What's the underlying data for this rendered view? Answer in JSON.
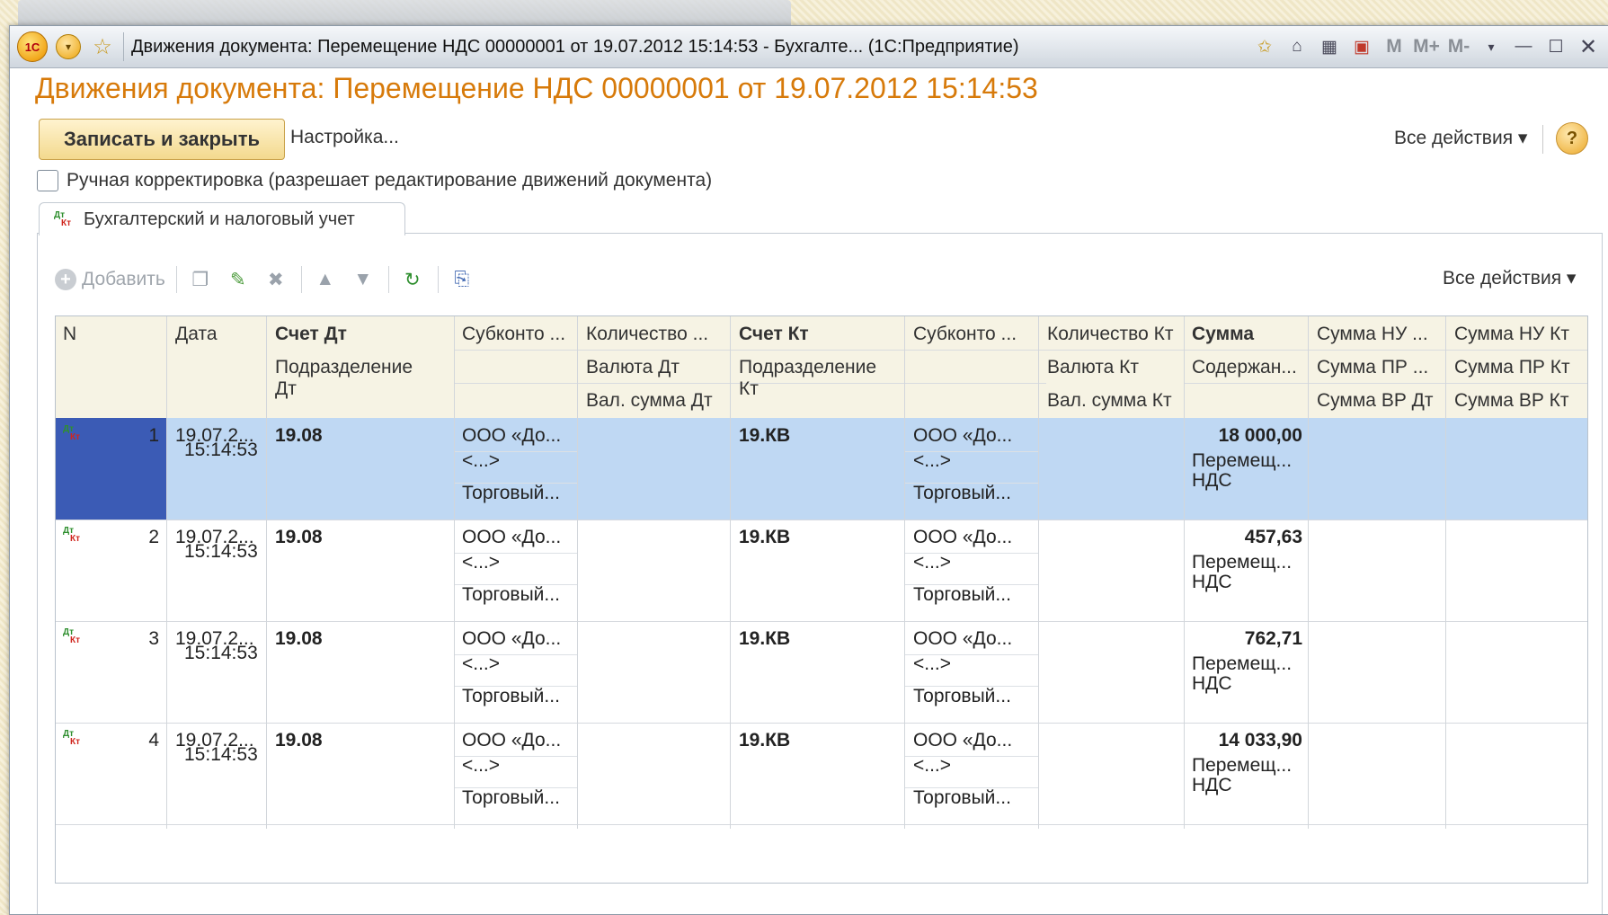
{
  "window": {
    "title": "Движения документа: Перемещение НДС 00000001 от 19.07.2012 15:14:53 - Бухгалте...  (1С:Предприятие)",
    "logo": "1С"
  },
  "document": {
    "heading": "Движения документа: Перемещение НДС 00000001 от 19.07.2012 15:14:53"
  },
  "actions": {
    "save_close": "Записать и закрыть",
    "settings": "Настройка...",
    "all_actions": "Все действия ▾",
    "help": "?"
  },
  "manual_edit": {
    "checked": false,
    "label": "Ручная корректировка (разрешает редактирование движений документа)"
  },
  "tab": {
    "icon_dt": "Дт",
    "icon_kt": "Кт",
    "label": "Бухгалтерский и налоговый учет"
  },
  "grid_toolbar": {
    "add": "Добавить",
    "all_actions": "Все действия ▾"
  },
  "titlebar_icons": {
    "m": "M",
    "m_plus": "M+",
    "m_minus": "M-"
  },
  "columns": {
    "n": "N",
    "date": "Дата",
    "acc_dt": "Счет Дт",
    "sub_dt": "Субконто ...",
    "qty_dt": "Количество ...",
    "acc_kt": "Счет Кт",
    "sub_kt": "Субконто ...",
    "qty_kt": "Количество Кт",
    "sum": "Сумма",
    "sum_nu_dt": "Сумма НУ ...",
    "sum_nu_kt": "Сумма НУ Кт",
    "dept_dt": "Подразделение Дт",
    "cur_dt": "Валюта Дт",
    "dept_kt": "Подразделение Кт",
    "cur_kt": "Валюта Кт",
    "content": "Содержан...",
    "sum_pr_dt": "Сумма ПР ...",
    "sum_pr_kt": "Сумма ПР Кт",
    "val_sum_dt": "Вал. сумма Дт",
    "val_sum_kt": "Вал. сумма Кт",
    "sum_vr_dt": "Сумма ВР Дт",
    "sum_vr_kt": "Сумма ВР Кт"
  },
  "rows": [
    {
      "n": "1",
      "date": "19.07.2...",
      "time": "15:14:53",
      "acc_dt": "19.08",
      "sub_dt_1": "ООО «До...",
      "sub_dt_2": "<...>",
      "sub_dt_3": "Торговый...",
      "acc_kt": "19.КВ",
      "sub_kt_1": "ООО «До...",
      "sub_kt_2": "<...>",
      "sub_kt_3": "Торговый...",
      "sum": "18 000,00",
      "content_1": "Перемещ...",
      "content_2": "НДС"
    },
    {
      "n": "2",
      "date": "19.07.2...",
      "time": "15:14:53",
      "acc_dt": "19.08",
      "sub_dt_1": "ООО «До...",
      "sub_dt_2": "<...>",
      "sub_dt_3": "Торговый...",
      "acc_kt": "19.КВ",
      "sub_kt_1": "ООО «До...",
      "sub_kt_2": "<...>",
      "sub_kt_3": "Торговый...",
      "sum": "457,63",
      "content_1": "Перемещ...",
      "content_2": "НДС"
    },
    {
      "n": "3",
      "date": "19.07.2...",
      "time": "15:14:53",
      "acc_dt": "19.08",
      "sub_dt_1": "ООО «До...",
      "sub_dt_2": "<...>",
      "sub_dt_3": "Торговый...",
      "acc_kt": "19.КВ",
      "sub_kt_1": "ООО «До...",
      "sub_kt_2": "<...>",
      "sub_kt_3": "Торговый...",
      "sum": "762,71",
      "content_1": "Перемещ...",
      "content_2": "НДС"
    },
    {
      "n": "4",
      "date": "19.07.2...",
      "time": "15:14:53",
      "acc_dt": "19.08",
      "sub_dt_1": "ООО «До...",
      "sub_dt_2": "<...>",
      "sub_dt_3": "Торговый...",
      "acc_kt": "19.КВ",
      "sub_kt_1": "ООО «До...",
      "sub_kt_2": "<...>",
      "sub_kt_3": "Торговый...",
      "sum": "14 033,90",
      "content_1": "Перемещ...",
      "content_2": "НДС"
    }
  ],
  "colors": {
    "accent": "#d77a0a",
    "selected_row": "#bfd8f3",
    "selected_marker": "#3b5bb5"
  }
}
